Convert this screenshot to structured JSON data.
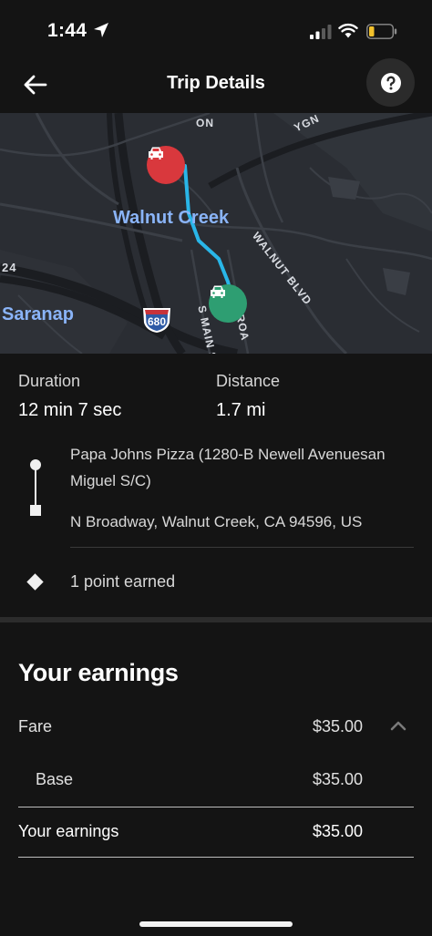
{
  "status_bar": {
    "time": "1:44",
    "icons": [
      "location-arrow-icon",
      "signal-icon",
      "wifi-icon",
      "battery-icon"
    ]
  },
  "header": {
    "title": "Trip Details",
    "back_icon": "back-arrow-icon",
    "help_icon": "help-icon"
  },
  "map": {
    "labels": {
      "city_walnut_creek": "Walnut Creek",
      "city_saranap": "Saranap",
      "road_walnut_blvd": "WALNUT BLVD",
      "road_24": "24",
      "road_ygn": "YGN",
      "road_on": "ON",
      "road_main": "S MAIN S",
      "road_broadway": "BROA",
      "highway_680": "680"
    },
    "route_color": "#29b6e8",
    "pickup_pin_color": "#d9383d",
    "dropoff_pin_color": "#2e9e72"
  },
  "trip": {
    "duration_label": "Duration",
    "duration_value": "12 min 7 sec",
    "distance_label": "Distance",
    "distance_value": "1.7 mi",
    "pickup": "Papa Johns Pizza (1280-B Newell Avenuesan Miguel S/C)",
    "dropoff": "N Broadway, Walnut Creek, CA 94596, US",
    "points": "1 point earned"
  },
  "earnings": {
    "title": "Your earnings",
    "fare_label": "Fare",
    "fare_amount": "$35.00",
    "base_label": "Base",
    "base_amount": "$35.00",
    "total_label": "Your earnings",
    "total_amount": "$35.00"
  }
}
